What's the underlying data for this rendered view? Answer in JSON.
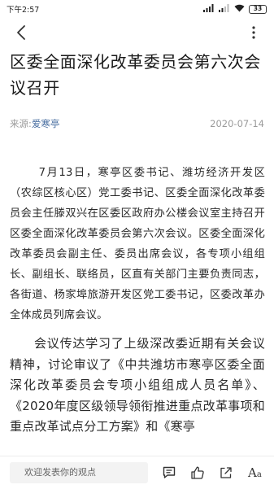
{
  "status_bar": {
    "time": "下午2:57",
    "battery": "33"
  },
  "article": {
    "title": "区委全面深化改革委员会第六次会议召开",
    "source_label": "来源:",
    "source_name": "爱寒亭",
    "date": "2020-07-14",
    "paragraphs": [
      "7月13日，寒亭区委书记、潍坊经济开发区（农综区核心区）党工委书记、区委全面深化改革委员会主任滕双兴在区委区政府办公楼会议室主持召开区委全面深化改革委员会第六次会议。区委全面深化改革委员会副主任、委员出席会议，各专项小组组长、副组长、联络员，区直有关部门主要负责同志，各街道、杨家埠旅游开发区党工委书记，区委改革办全体成员列席会议。",
      "会议传达学习了上级深改委近期有关会议精神，讨论审议了《中共潍坊市寒亭区委全面深化改革委员会专项小组组成人员名单》、《2020年度区级领导领衔推进重点改革事项和重点改革试点分工方案》和《寒亭"
    ]
  },
  "bottom_bar": {
    "comment_placeholder": "欢迎发表你的观点",
    "font_size_label_big": "A",
    "font_size_label_small": "a"
  },
  "icons": {
    "back": "back-arrow-icon",
    "more": "more-vertical-icon",
    "comment": "comment-icon",
    "like": "thumbs-up-icon",
    "share": "share-icon",
    "font": "font-size-icon"
  }
}
